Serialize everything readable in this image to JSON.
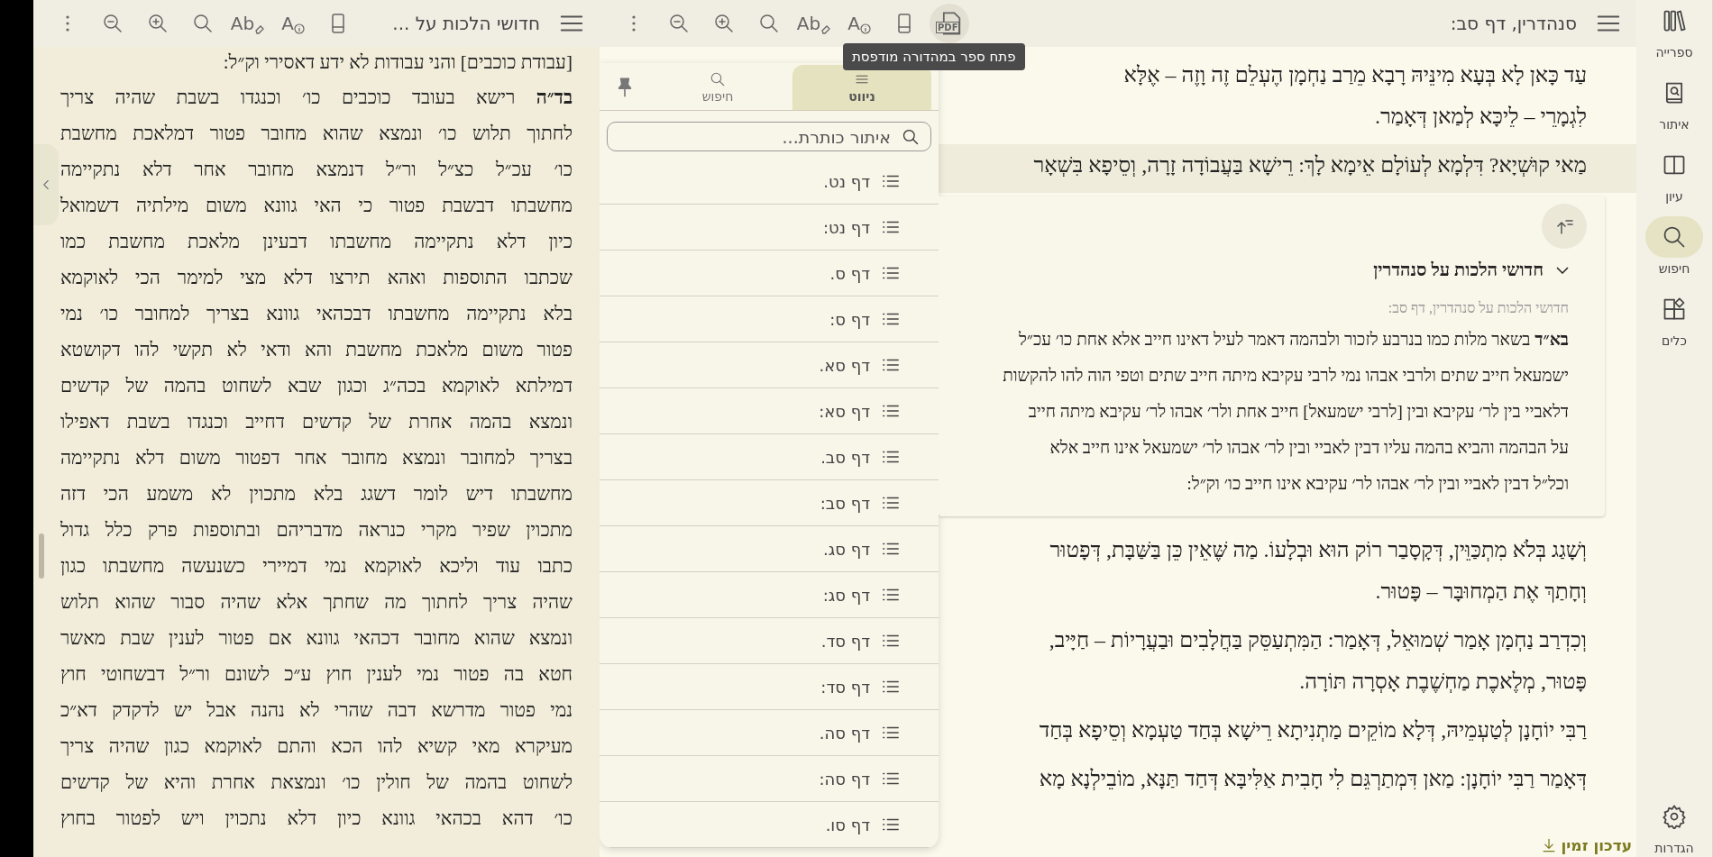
{
  "left_panel": {
    "title": "חדושי הלכות על ...",
    "tools": [
      {
        "kind": "tablet",
        "selected": false
      },
      {
        "kind": "font-info",
        "glyph": "A",
        "selected": false
      },
      {
        "kind": "clear-format",
        "glyph": "Ab",
        "selected": false
      },
      {
        "kind": "search",
        "selected": false
      },
      {
        "kind": "zoom-in",
        "selected": false
      },
      {
        "kind": "zoom-out",
        "selected": false
      },
      {
        "kind": "more",
        "selected": false
      }
    ],
    "top_line": "[עבודת כוכבים] והני עבודות לא ידע דאסירי וק״ל:",
    "lines": [
      "**בד״ה** רישא בעובד כוכבים כו׳ וכנגדו בשבת שהיה צריך",
      "לחתוך תלוש כו׳ ונמצא שהוא מחובר פטור דמלאכת מחשבת",
      "כו׳ עכ״ל כצ״ל ור״ל דנמצא מחובר אחר דלא נתקיימה",
      "מחשבתו דבשבת פטור כי האי גוונא משום מילתיה דשמואל",
      "כיון דלא נתקיימה מחשבתו דבעינן מלאכת מחשבת כמו",
      "שכתבו התוספות ואהא תירצו דלא מצי למימר הכי לאוקמא",
      "בלא נתקיימה מחשבתו דבכהאי גוונא בצריך למחובר כו׳ נמי",
      "פטור משום מלאכת מחשבת והא ודאי לא תקשי להו דקושטא",
      "דמילתא לאוקמא בכה״ג וכגון שבא לשחוט בהמה של קדשים",
      "ונמצא בהמה אחרת של קדשים דחייב וכנגדו בשבת דאפילו",
      "בצריך למחובר ונמצא מחובר אחר דפטור משום דלא נתקיימה",
      "מחשבתו דיש לומר דשגג בלא מתכוין לא משמע הכי דזה",
      "מתכוין שפיר מקרי כנראה מדבריהם ובתוספות פרק כלל גדול",
      "כתבו עוד וליכא לאוקמא נמי דמיירי כשנעשה מחשבתו כגון",
      "שהיה צריך לחתוך מה שחתך אלא שהיה סבור שהוא תלוש",
      "ונמצא שהוא מחובר דכהאי גוונא אם פטור לענין שבת מאשר",
      "חטא בה פטור נמי לענין חוץ ע״כ לשונם ור״ל דבשחוטי חוץ",
      "נמי פטור מדרשא דבה שהרי לא נהנה אבל יש לדקדק דא״כ",
      "מעיקרא מאי קשיא להו הכא והתם לאוקמא כגון שהיה צריך",
      "לשחוט בהמה של חולין כו׳ ונמצאת אחרת והיא של קדשים",
      "כו׳ דהא בכהאי גוונא כיון דלא נתכוין ויש לפטור בחוץ"
    ]
  },
  "main": {
    "title": "סנהדרין, דף סב:",
    "tools": [
      {
        "kind": "pdf",
        "glyph": "PDF",
        "selected": true
      },
      {
        "kind": "tablet",
        "selected": false
      },
      {
        "kind": "font-info",
        "glyph": "A",
        "selected": false
      },
      {
        "kind": "clear-format",
        "glyph": "Ab",
        "selected": false
      },
      {
        "kind": "search",
        "selected": false
      },
      {
        "kind": "zoom-in",
        "selected": false
      },
      {
        "kind": "zoom-out",
        "selected": false
      },
      {
        "kind": "more",
        "selected": false
      }
    ],
    "tooltip": "פתח ספר במהדורה מודפסת",
    "passages_before": [
      {
        "selected": false,
        "lines": [
          "עַד כָּאן לָא בְּעָא מִינֵּיהּ רָבָא מֵרַב נַחְמָן הֶעְלֵם זֶה וָזֶה – אֶלָּא",
          "לִגְמָרֵי – לֵיכָּא לְמַאן דְּאָמַר."
        ]
      },
      {
        "selected": true,
        "lines": [
          "מַאי קוּשְׁיָא? דִּלְמָא לְעוֹלָם אֵימָא לָךְ: רֵישָׁא בַּעֲבוֹדָה זָרָה, וְסֵיפָא בִּשְׁאָר"
        ]
      }
    ],
    "commentary": {
      "heading": "חדושי הלכות על סנהדרין",
      "expanded": true,
      "subtitle": "חדושי הלכות על סנהדרין, דף סב:",
      "lines": [
        "**בא״ד** בשאר מלות כמו בנרבע לזכור ולבהמה דאמר לעיל דאינו חייב אלא אחת כו׳ עכ״ל",
        "ישמעאל חייב שתים ולרבי אבהו נמי לרבי עקיבא מיתה חייב שתים וטפי הוה להו להקשות",
        "דלאביי בין לר׳ עקיבא ובין [לרבי ישמעאל] חייב אחת ולר׳ אבהו לר׳ עקיבא מיתה חייב",
        "על הבהמה והביא בהמה עליו דבין לאביי ובין לר׳ אבהו לר׳ ישמעאל אינו חייב אלא",
        "וכל״ל דבין לאביי ובין לר׳ אבהו לר׳ עקיבא אינו חייב כו׳ וק״ל:"
      ]
    },
    "passages_after": [
      {
        "selected": false,
        "lines": [
          "וְשָׁגַג בְּלֹא מִתְכַּוֵּין, דְּקָסָבַר רוֹק הוּא וּבְלָעוֹ. מַה שֶּׁאֵין כֵּן בַּשַּׁבָּת, דְּפָטוּר",
          "וְחָתַךְ אֶת הַמְחוּבָּר – פָּטוּר."
        ]
      },
      {
        "selected": false,
        "lines": [
          "וְכִדְרַב נַחְמָן אָמַר שְׁמוּאֵל, דְּאָמַר: הַמִּתְעַסֵּק בַּחֲלָבִים וּבַעֲרָיוֹת – חַיָּיב,",
          "פָּטוּר, מְלֶאכֶת מַחְשֶׁבֶת אָסְרָה תּוֹרָה."
        ]
      },
      {
        "selected": false,
        "lines": [
          "רַבִּי יוֹחָנָן לְטַעְמֵיהּ, דְּלָא מוֹקֵים מַתְנִיתָא רֵישָׁא בְּחַד טַעְמָא וְסֵיפָא בְּחַד"
        ]
      },
      {
        "selected": false,
        "lines": [
          "דְּאָמַר רַבִּי יוֹחָנָן: מַאן דִּמְתַרְגֵּם לִי חָבִית אַלִּיבָּא דְּחַד תַּנָּא, מוֹבֵילְנָא מָא"
        ]
      }
    ]
  },
  "navigation_panel": {
    "tabs": [
      {
        "kind": "navigate",
        "label": "ניווט",
        "selected": true
      },
      {
        "kind": "search",
        "label": "חיפוש",
        "selected": false
      }
    ],
    "search": {
      "placeholder": "איתור כותרת..."
    },
    "items": [
      "דף נט.",
      "דף נט:",
      "דף ס.",
      "דף ס:",
      "דף סא.",
      "דף סא:",
      "דף סב.",
      "דף סב:",
      "דף סג.",
      "דף סג:",
      "דף סד.",
      "דף סד:",
      "דף סה.",
      "דף סה:",
      "דף סו."
    ]
  },
  "sidebar": {
    "items": [
      {
        "kind": "library",
        "label": "ספרייה",
        "selected": false
      },
      {
        "kind": "locate",
        "label": "איתור",
        "selected": false
      },
      {
        "kind": "study",
        "label": "עיון",
        "selected": false
      },
      {
        "kind": "search",
        "label": "חיפוש",
        "selected": true
      },
      {
        "kind": "tools",
        "label": "כלים",
        "selected": false
      }
    ],
    "settings": "הגדרות"
  },
  "update_notice": "עדכון זמין"
}
